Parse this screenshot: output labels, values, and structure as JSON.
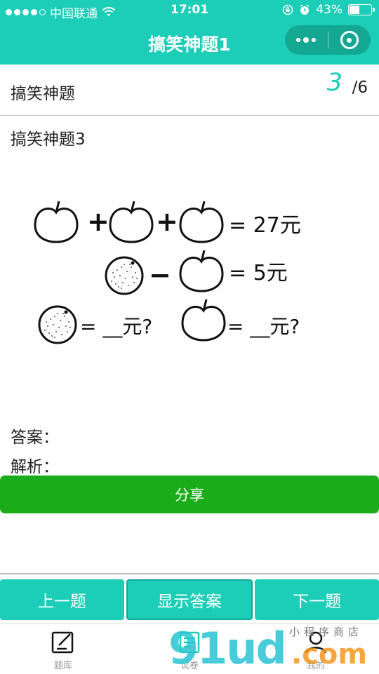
{
  "status_bar": {
    "carrier": "中国联通",
    "time": "17:01",
    "battery": "43%"
  },
  "navbar": {
    "title": "搞笑神题1"
  },
  "question": {
    "category": "搞笑神题",
    "current": "3",
    "total": "/6",
    "title": "搞笑神题3"
  },
  "puzzle_image": {
    "line1": "= 27元",
    "line2": "= 5元",
    "line3a": "= __元?",
    "line3b": "= __元?"
  },
  "answer_label": "答案：",
  "analysis_label": "解析：",
  "share_label": "分享",
  "bottom_buttons": {
    "prev": "上一题",
    "show": "显示答案",
    "next": "下一题"
  },
  "tabs": [
    {
      "label": "题库",
      "icon": "edit-icon"
    },
    {
      "label": "试卷",
      "icon": "paper-icon"
    },
    {
      "label": "我的",
      "icon": "user-icon"
    }
  ],
  "watermark": {
    "brand": "91ud",
    "domain": ".com",
    "tag": "小程序商店"
  },
  "colors": {
    "accent": "#1ccdb7",
    "share": "#1aad19"
  }
}
